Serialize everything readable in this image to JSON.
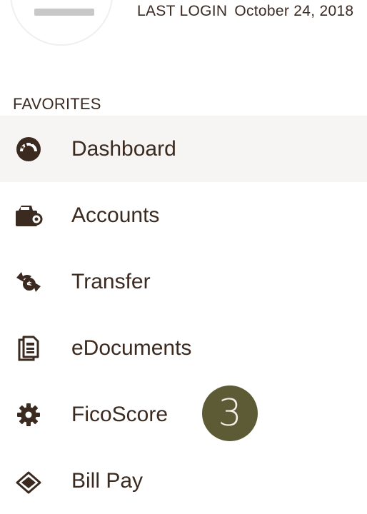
{
  "profile": {
    "last_login_label": "LAST LOGIN",
    "last_login_value": "October 24, 2018"
  },
  "favorites": {
    "title": "FAVORITES",
    "items": [
      {
        "label": "Dashboard",
        "icon": "dashboard-gauge-icon"
      },
      {
        "label": "Accounts",
        "icon": "wallet-icon"
      },
      {
        "label": "Transfer",
        "icon": "transfer-arrows-icon"
      },
      {
        "label": "eDocuments",
        "icon": "documents-icon"
      },
      {
        "label": "FicoScore",
        "icon": "gear-icon"
      },
      {
        "label": "Bill Pay",
        "icon": "bill-icon"
      }
    ],
    "active_index": 0
  },
  "annotation_badge": {
    "text": "3"
  },
  "colors": {
    "text": "#3b2a20",
    "active_bg": "#f6f5f4",
    "badge_bg": "#5d5b35"
  }
}
